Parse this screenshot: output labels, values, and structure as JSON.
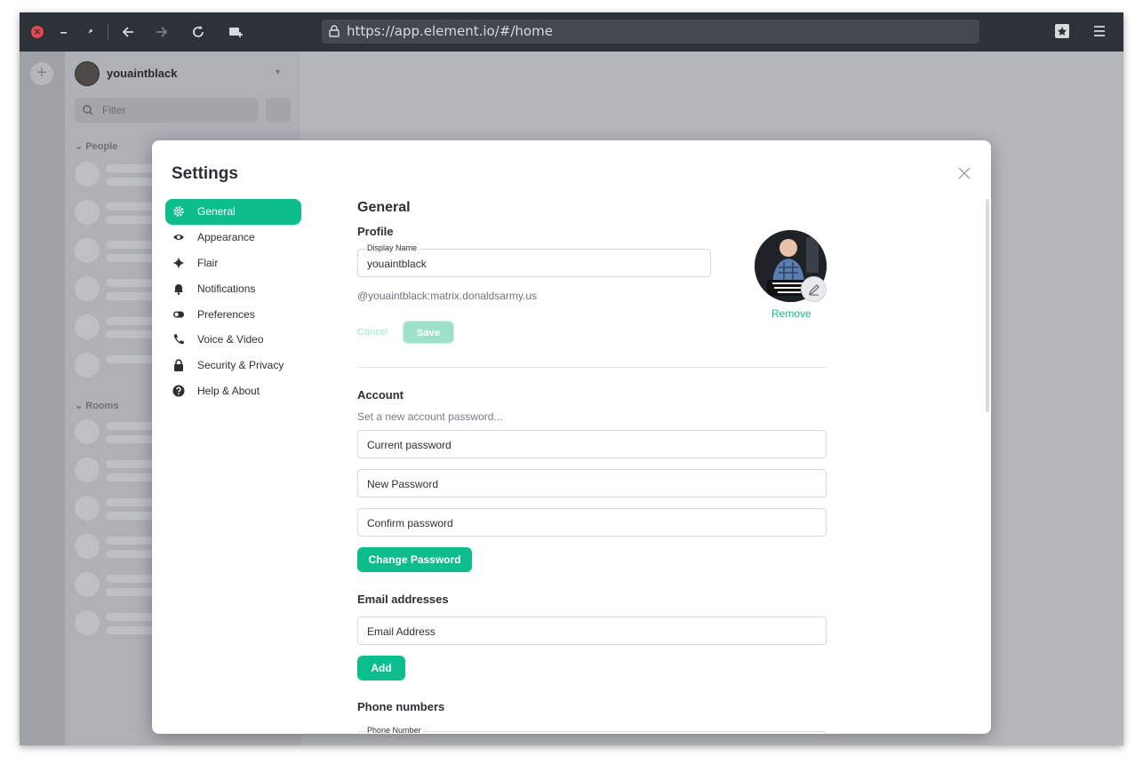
{
  "browser": {
    "url": "https://app.element.io/#/home",
    "icons": [
      "close-icon",
      "minimize-icon",
      "restore-icon",
      "back-icon",
      "forward-icon",
      "reload-icon",
      "new-tab-icon",
      "lock-icon",
      "bookmark-icon",
      "menu-icon"
    ]
  },
  "left_panel": {
    "username": "youaintblack",
    "filter_placeholder": "Filter",
    "section_people": "People",
    "section_rooms": "Rooms"
  },
  "settings": {
    "title": "Settings",
    "nav": [
      {
        "label": "General",
        "icon": "gear-icon",
        "active": true
      },
      {
        "label": "Appearance",
        "icon": "eye-icon",
        "active": false
      },
      {
        "label": "Flair",
        "icon": "sparkle-icon",
        "active": false
      },
      {
        "label": "Notifications",
        "icon": "bell-icon",
        "active": false
      },
      {
        "label": "Preferences",
        "icon": "toggle-icon",
        "active": false
      },
      {
        "label": "Voice & Video",
        "icon": "phone-icon",
        "active": false
      },
      {
        "label": "Security & Privacy",
        "icon": "lock-icon",
        "active": false
      },
      {
        "label": "Help & About",
        "icon": "help-icon",
        "active": false
      }
    ],
    "general": {
      "heading": "General",
      "profile": {
        "heading": "Profile",
        "display_name_label": "Display Name",
        "display_name_value": "youaintblack",
        "matrix_id": "@youaintblack:matrix.donaldsarmy.us",
        "cancel_label": "Cancel",
        "save_label": "Save",
        "remove_label": "Remove"
      },
      "account": {
        "heading": "Account",
        "hint": "Set a new account password...",
        "current_password_placeholder": "Current password",
        "new_password_placeholder": "New Password",
        "confirm_password_placeholder": "Confirm password",
        "change_password_label": "Change Password"
      },
      "email": {
        "heading": "Email addresses",
        "placeholder": "Email Address",
        "add_label": "Add"
      },
      "phone": {
        "heading": "Phone numbers",
        "label": "Phone Number"
      }
    }
  },
  "colors": {
    "accent": "#0dbd8b",
    "toolbar": "#2d3238",
    "text": "#2e2f32"
  }
}
